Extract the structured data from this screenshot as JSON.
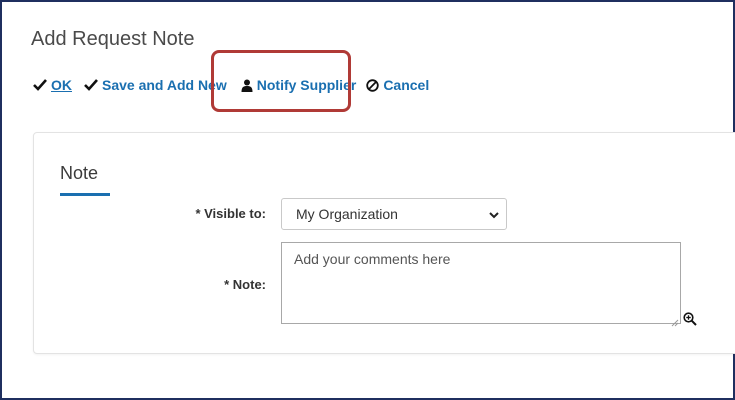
{
  "page": {
    "title": "Add Request Note"
  },
  "toolbar": {
    "ok_label": "OK",
    "save_new_label": "Save and Add New",
    "notify_label": "Notify Supplier",
    "cancel_label": "Cancel"
  },
  "form": {
    "section_tab": "Note",
    "visible_to": {
      "label": "* Visible to:",
      "selected": "My Organization"
    },
    "note": {
      "label": "* Note:",
      "placeholder": "Add your comments here"
    }
  },
  "icons": [
    "check-icon",
    "check-icon",
    "user-icon",
    "cancel-circle-icon",
    "chevron-down-icon",
    "zoom-in-icon",
    "resize-grip-icon"
  ],
  "colors": {
    "link": "#1a6fb0",
    "highlight": "#b03a36",
    "frame": "#1f2f5f",
    "tab_underline": "#1a6fb0"
  }
}
